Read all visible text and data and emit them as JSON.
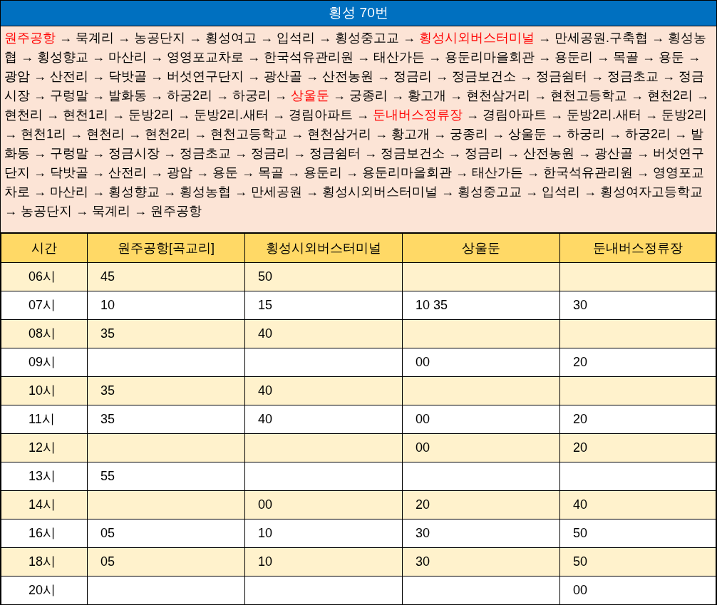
{
  "title": "횡성 70번",
  "route": [
    {
      "text": "원주공항",
      "highlighted": true
    },
    {
      "text": " → 묵계리 → 농공단지 → 횡성여고 → 입석리 → 횡성중고교 → ",
      "highlighted": false
    },
    {
      "text": "횡성시외버스터미널",
      "highlighted": true
    },
    {
      "text": " → 만세공원.구축협 → 횡성농협 → 횡성향교 → 마산리 → 영영포교차로 → 한국석유관리원 → 태산가든 → 용둔리마을회관 → 용둔리 → 목골 → 용둔 → 광암 → 산전리 → 닥밧골 → 버섯연구단지 → 광산골 → 산전농원 → 정금리 → 정금보건소 → 정금쉼터 → 정금초교 → 정금시장 → 구렁말 → 발화동 → 하궁2리 → 하궁리 → ",
      "highlighted": false
    },
    {
      "text": "상울둔",
      "highlighted": true
    },
    {
      "text": " → 궁종리 → 황고개 → 현천삼거리 → 현천고등학교 → 현천2리 → 현천리 → 현천1리 → 둔방2리 → 둔방2리.새터 → 경림아파트 → ",
      "highlighted": false
    },
    {
      "text": "둔내버스정류장",
      "highlighted": true
    },
    {
      "text": " → 경림아파트 → 둔방2리.새터 → 둔방2리 → 현천1리 → 현천리 → 현천2리 → 현천고등학교 → 현천삼거리 → 황고개 → 궁종리 → 상울둔 → 하궁리 → 하궁2리 → 발화동 → 구렁말 → 정금시장 → 정금초교 → 정금리 → 정금쉼터 → 정금보건소 → 정금리 → 산전농원 → 광산골 → 버섯연구단지 → 닥밧골 → 산전리 → 광암 → 용둔 → 목골 → 용둔리 → 용둔리마을회관 → 태산가든 → 한국석유관리원 → 영영포교차로 → 마산리 → 횡성향교 → 횡성농협 → 만세공원 → 횡성시외버스터미널 → 횡성중고교 → 입석리 → 횡성여자고등학교 → 농공단지 → 묵계리 → 원주공항",
      "highlighted": false
    }
  ],
  "table": {
    "columns": [
      "시간",
      "원주공항[곡교리]",
      "횡성시외버스터미널",
      "상울둔",
      "둔내버스정류장"
    ],
    "rows": [
      [
        "06시",
        "45",
        "50",
        "",
        ""
      ],
      [
        "07시",
        "10",
        "15",
        "10 35",
        "30"
      ],
      [
        "08시",
        "35",
        "40",
        "",
        ""
      ],
      [
        "09시",
        "",
        "",
        "00",
        "20"
      ],
      [
        "10시",
        "35",
        "40",
        "",
        ""
      ],
      [
        "11시",
        "35",
        "40",
        "00",
        "20"
      ],
      [
        "12시",
        "",
        "",
        "00",
        "20"
      ],
      [
        "13시",
        "55",
        "",
        "",
        ""
      ],
      [
        "14시",
        "",
        "00",
        "20",
        "40"
      ],
      [
        "16시",
        "05",
        "10",
        "30",
        "50"
      ],
      [
        "18시",
        "05",
        "10",
        "30",
        "50"
      ],
      [
        "20시",
        "",
        "",
        "",
        "00"
      ]
    ]
  }
}
